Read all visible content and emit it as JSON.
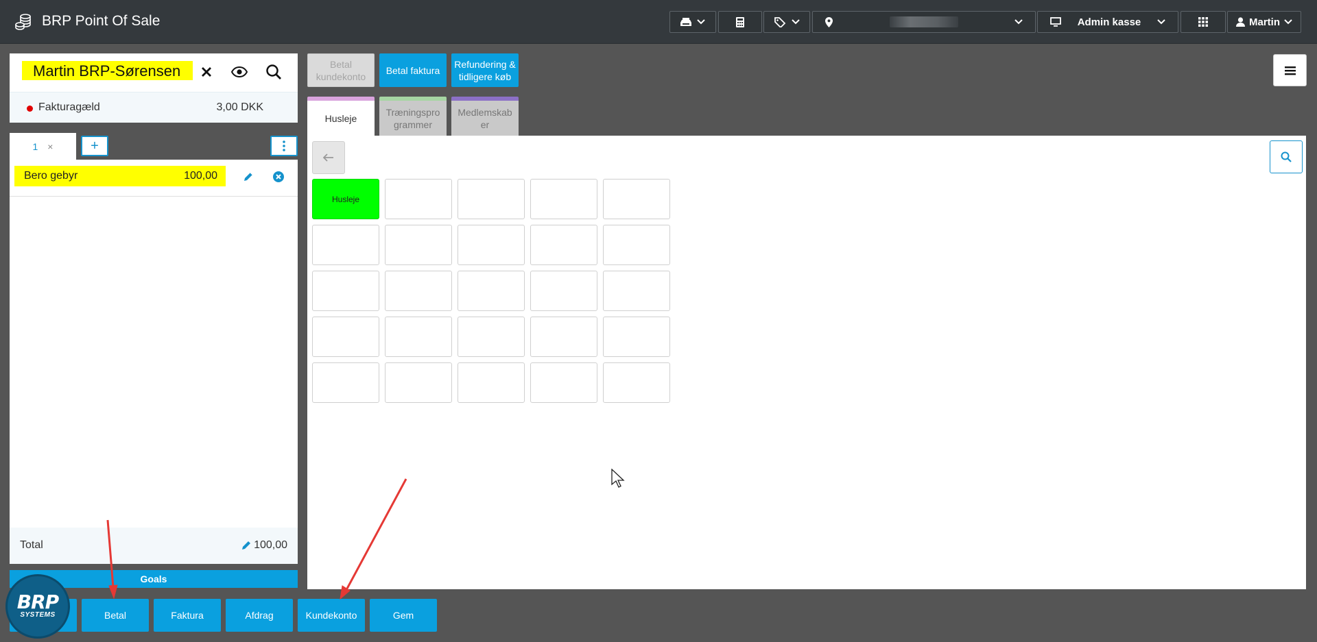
{
  "app": {
    "title": "BRP Point Of Sale",
    "logo_icon": "coins-stack-icon"
  },
  "topbar": {
    "printer_icon": "printer-icon",
    "calculator_icon": "calculator-icon",
    "tags_icon": "tags-icon",
    "location_icon": "map-pin-icon",
    "register_label": "Admin kasse",
    "user_label": "Martin"
  },
  "customer": {
    "name": "Martin BRP-Sørensen",
    "debt_label": "Fakturagæld",
    "debt_value": "3,00 DKK"
  },
  "cart": {
    "tab_label": "1",
    "tab_close": "×",
    "add_tab": "+",
    "lines": [
      {
        "name": "Bero gebyr",
        "amount": "100,00"
      }
    ],
    "total_label": "Total",
    "total_value": "100,00",
    "goals_label": "Goals"
  },
  "actions": {
    "betal": "Betal",
    "faktura": "Faktura",
    "afdrag": "Afdrag",
    "kundekonto": "Kundekonto",
    "gem": "Gem"
  },
  "logo": {
    "line1": "BRP",
    "line2": "SYSTEMS"
  },
  "top_actions": {
    "betal_kundekonto": "Betal kundekonto",
    "betal_faktura": "Betal faktura",
    "refundering": "Refundering & tidligere køb"
  },
  "categories": [
    {
      "label": "Husleje",
      "active": true
    },
    {
      "label": "Træningsprogrammer",
      "active": false
    },
    {
      "label": "Medlemskaber",
      "active": false
    }
  ],
  "products": {
    "tiles": [
      "Husleje",
      "",
      "",
      "",
      "",
      "",
      "",
      "",
      "",
      "",
      "",
      "",
      "",
      "",
      "",
      "",
      "",
      "",
      "",
      "",
      "",
      "",
      "",
      "",
      ""
    ]
  },
  "colors": {
    "accent": "#0aa0df",
    "highlight": "#ffff00",
    "tile_active": "#00ff00",
    "topbar": "#34393d",
    "background": "#555555",
    "annotation": "#e53935"
  }
}
